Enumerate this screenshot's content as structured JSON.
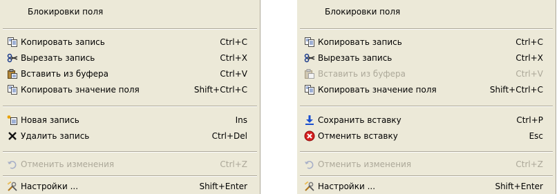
{
  "left_menu": {
    "header": "Блокировки поля",
    "items": [
      {
        "label": "Копировать запись",
        "shortcut": "Ctrl+C",
        "icon": "copy-icon"
      },
      {
        "label": "Вырезать запись",
        "shortcut": "Ctrl+X",
        "icon": "cut-icon"
      },
      {
        "label": "Вставить из буфера",
        "shortcut": "Ctrl+V",
        "icon": "paste-icon"
      },
      {
        "label": "Копировать значение поля",
        "shortcut": "Shift+Ctrl+C",
        "icon": "copy-icon"
      },
      {
        "label": "Новая запись",
        "shortcut": "Ins",
        "icon": "new-record-icon"
      },
      {
        "label": "Удалить запись",
        "shortcut": "Ctrl+Del",
        "icon": "delete-icon"
      },
      {
        "label": "Отменить изменения",
        "shortcut": "Ctrl+Z",
        "icon": "undo-icon",
        "disabled": true
      },
      {
        "label": "Настройки ...",
        "shortcut": "Shift+Enter",
        "icon": "settings-icon"
      }
    ]
  },
  "right_menu": {
    "header": "Блокировки поля",
    "items": [
      {
        "label": "Копировать запись",
        "shortcut": "Ctrl+C",
        "icon": "copy-icon"
      },
      {
        "label": "Вырезать запись",
        "shortcut": "Ctrl+X",
        "icon": "cut-icon"
      },
      {
        "label": "Вставить из буфера",
        "shortcut": "Ctrl+V",
        "icon": "paste-icon",
        "disabled": true
      },
      {
        "label": "Копировать значение поля",
        "shortcut": "Shift+Ctrl+C",
        "icon": "copy-icon"
      },
      {
        "label": "Сохранить вставку",
        "shortcut": "Ctrl+P",
        "icon": "save-icon"
      },
      {
        "label": "Отменить вставку",
        "shortcut": "Esc",
        "icon": "cancel-icon"
      },
      {
        "label": "Отменить изменения",
        "shortcut": "Ctrl+Z",
        "icon": "undo-icon",
        "disabled": true
      },
      {
        "label": "Настройки ...",
        "shortcut": "Shift+Enter",
        "icon": "settings-icon"
      }
    ]
  },
  "colors": {
    "menu_background": "#ece9d8",
    "disabled_text": "#aca899",
    "separator": "#aca899"
  }
}
